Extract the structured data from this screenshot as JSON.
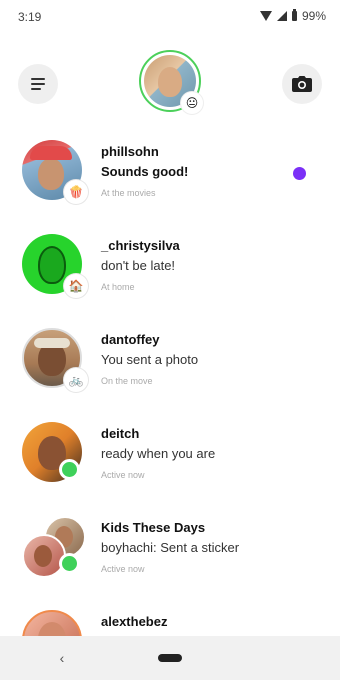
{
  "status_bar": {
    "time": "3:19",
    "battery": "99%"
  },
  "header": {
    "profile_emoji": "😐"
  },
  "chats": [
    {
      "name": "phillsohn",
      "message": "Sounds good!",
      "status": "At the movies",
      "badge": "🍿",
      "unread": true,
      "unread_color": "#7b2ff7"
    },
    {
      "name": "_christysilva",
      "message": "don't be late!",
      "status": "At home",
      "badge": "🏠"
    },
    {
      "name": "dantoffey",
      "message": "You sent a photo",
      "status": "On the move",
      "badge": "🚲"
    },
    {
      "name": "deitch",
      "message": "ready when you are",
      "status": "Active now",
      "online": true
    },
    {
      "name": "Kids These Days",
      "message": "boyhachi: Sent a sticker",
      "status": "Active now",
      "online": true
    },
    {
      "name": "alexthebez",
      "message": "",
      "status": ""
    }
  ],
  "colors": {
    "online": "#3fd15a",
    "profile_ring": "#4cd05a",
    "nav_bar": "#f1f1f1"
  }
}
